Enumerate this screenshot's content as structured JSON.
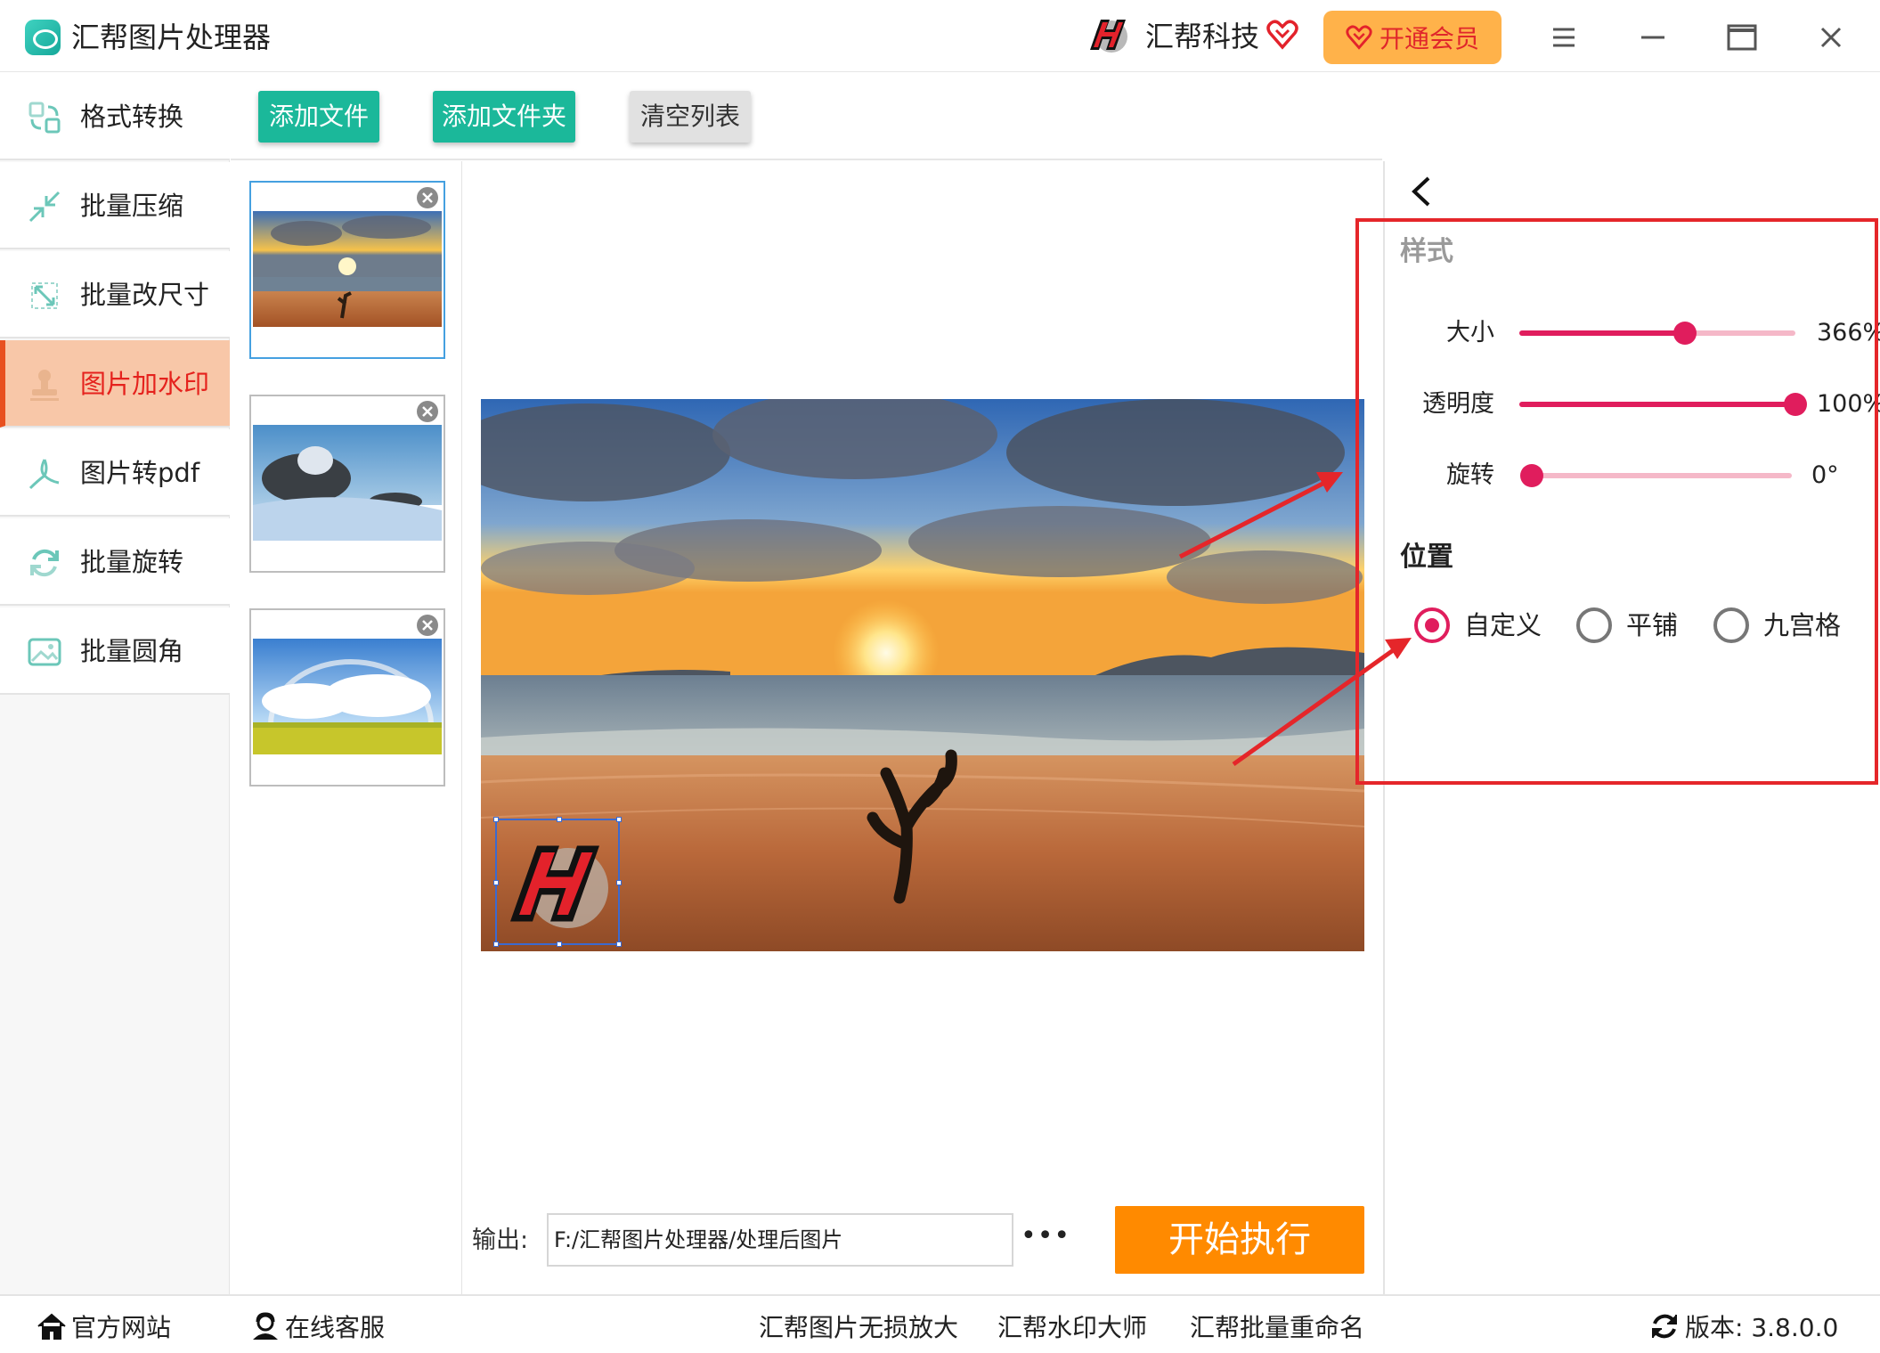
{
  "app": {
    "title": "汇帮图片处理器",
    "brand_name": "汇帮科技",
    "vip_label": "开通会员"
  },
  "sidebar": {
    "items": [
      {
        "label": "格式转换",
        "icon": "format-convert-icon",
        "active": false
      },
      {
        "label": "批量压缩",
        "icon": "compress-icon",
        "active": false
      },
      {
        "label": "批量改尺寸",
        "icon": "resize-icon",
        "active": false
      },
      {
        "label": "图片加水印",
        "icon": "stamp-icon",
        "active": true
      },
      {
        "label": "图片转pdf",
        "icon": "pdf-icon",
        "active": false
      },
      {
        "label": "批量旋转",
        "icon": "rotate-icon",
        "active": false
      },
      {
        "label": "批量圆角",
        "icon": "rounded-corner-icon",
        "active": false
      }
    ]
  },
  "toolbar": {
    "add_file": "添加文件",
    "add_folder": "添加文件夹",
    "clear_list": "清空列表"
  },
  "thumbnails": [
    {
      "subject": "beach sunset",
      "selected": true
    },
    {
      "subject": "snowy trees",
      "selected": false
    },
    {
      "subject": "rainbow over field",
      "selected": false
    }
  ],
  "output": {
    "label": "输出:",
    "path": "F:/汇帮图片处理器/处理后图片",
    "more": "•••"
  },
  "start_label": "开始执行",
  "settings": {
    "style_title": "样式",
    "sliders": [
      {
        "label": "大小",
        "value_text": "366%",
        "fraction": 0.6
      },
      {
        "label": "透明度",
        "value_text": "100%",
        "fraction": 1.0
      },
      {
        "label": "旋转",
        "value_text": "0°",
        "fraction": 0.0
      }
    ],
    "position_title": "位置",
    "position_options": [
      {
        "label": "自定义",
        "checked": true
      },
      {
        "label": "平铺",
        "checked": false
      },
      {
        "label": "九宫格",
        "checked": false
      }
    ]
  },
  "statusbar": {
    "website": "官方网站",
    "support": "在线客服",
    "link1": "汇帮图片无损放大",
    "link2": "汇帮水印大师",
    "link3": "汇帮批量重命名",
    "version": "版本: 3.8.0.0"
  },
  "colors": {
    "accent_green": "#1bb89a",
    "start_orange": "#ff8a00",
    "slider_pink": "#e01d5d",
    "highlight_red": "#e5262a",
    "active_nav": "#f8c7a8"
  }
}
